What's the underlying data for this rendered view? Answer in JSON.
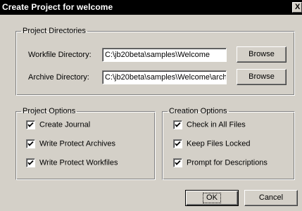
{
  "window": {
    "title": "Create Project for welcome",
    "close_glyph": "X"
  },
  "project_directories": {
    "legend": "Project Directories",
    "workfile_label": "Workfile Directory:",
    "workfile_value": "C:\\jb20beta\\samples\\Welcome",
    "archive_label": "Archive Directory:",
    "archive_value": "C:\\jb20beta\\samples\\Welcome\\archi",
    "browse_label": "Browse"
  },
  "project_options": {
    "legend": "Project Options",
    "items": [
      {
        "label": "Create Journal",
        "checked": true
      },
      {
        "label": "Write Protect Archives",
        "checked": true
      },
      {
        "label": "Write Protect Workfiles",
        "checked": true
      }
    ]
  },
  "creation_options": {
    "legend": "Creation Options",
    "items": [
      {
        "label": "Check in All Files",
        "checked": true
      },
      {
        "label": "Keep Files Locked",
        "checked": true
      },
      {
        "label": "Prompt for Descriptions",
        "checked": true
      }
    ]
  },
  "buttons": {
    "ok": "OK",
    "cancel": "Cancel"
  }
}
